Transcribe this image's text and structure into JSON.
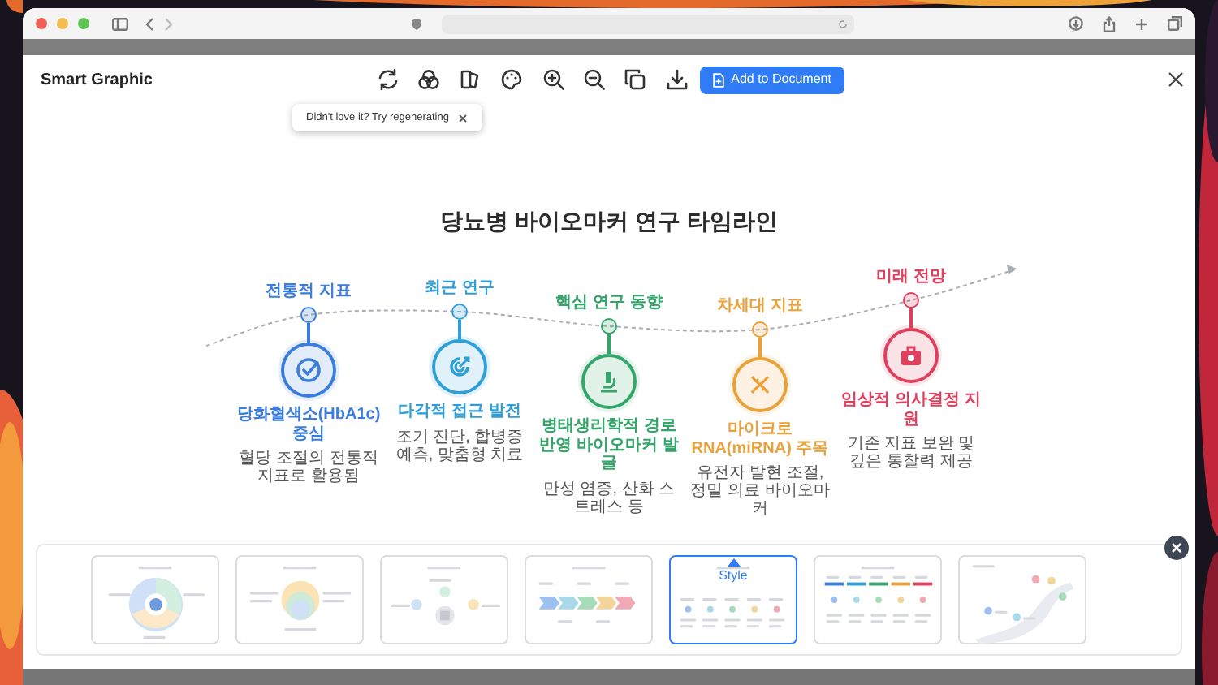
{
  "app": {
    "title": "Smart Graphic",
    "add_button": "Add to Document"
  },
  "tooltip": {
    "text": "Didn't love it? Try regenerating"
  },
  "graphic": {
    "title": "당뇨병 바이오마커 연구 타임라인",
    "stages": [
      {
        "label": "전통적 지표",
        "title": "당화혈색소(HbA1c) 중심",
        "description": "혈당 조절의 전통적 지표로 활용됨",
        "color": "#3b7ddd"
      },
      {
        "label": "최근 연구",
        "title": "다각적 접근 발전",
        "description": "조기 진단, 합병증 예측, 맞춤형 치료",
        "color": "#2f9fd8"
      },
      {
        "label": "핵심 연구 동향",
        "title": "병태생리학적 경로 반영 바이오마커 발굴",
        "description": "만성 염증, 산화 스트레스 등",
        "color": "#34a56b"
      },
      {
        "label": "차세대 지표",
        "title": "마이크로RNA(miRNA) 주목",
        "description": "유전자 발현 조절, 정밀 의료 바이오마커",
        "color": "#e9a23a"
      },
      {
        "label": "미래 전망",
        "title": "임상적 의사결정 지원",
        "description": "기존 지표 보완 및 깊은 통찰력 제공",
        "color": "#e0405e"
      }
    ]
  },
  "styles": {
    "badge": "Style",
    "thumbnails": [
      {
        "kind": "radial",
        "selected": false
      },
      {
        "kind": "venn",
        "selected": false
      },
      {
        "kind": "hub",
        "selected": false
      },
      {
        "kind": "chevron",
        "selected": false
      },
      {
        "kind": "timeline",
        "selected": true
      },
      {
        "kind": "columns",
        "selected": false
      },
      {
        "kind": "road",
        "selected": false
      }
    ]
  }
}
